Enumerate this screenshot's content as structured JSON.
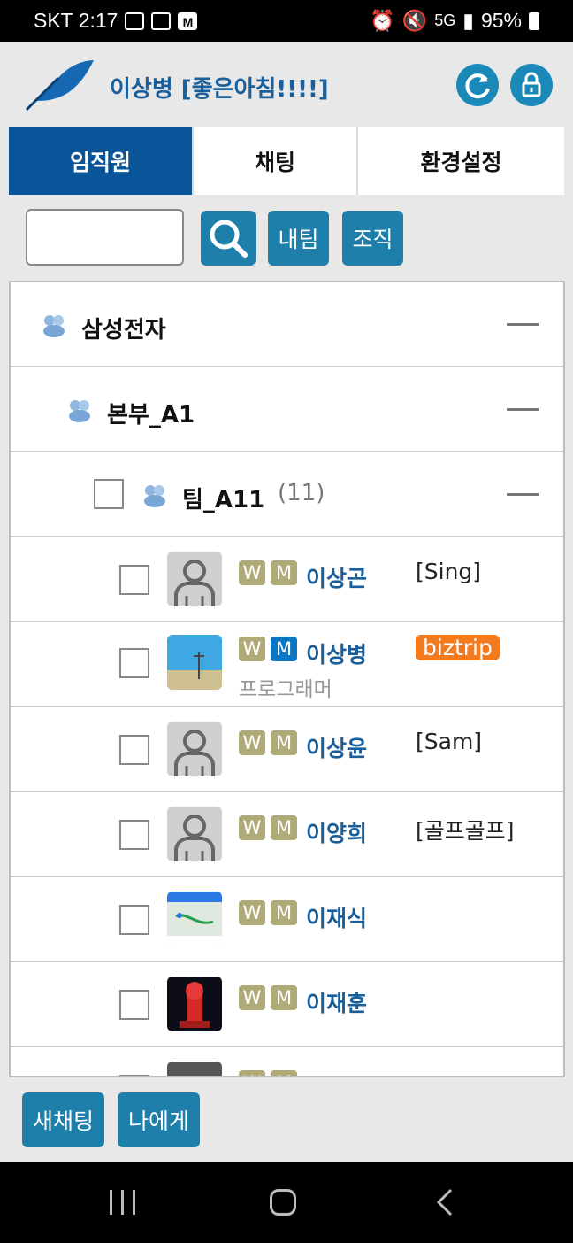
{
  "status_bar": {
    "carrier_time": "SKT 2:17",
    "battery": "95%",
    "icons": [
      "gallery-icon",
      "volte-icon",
      "stock-app-icon",
      "alarm-icon",
      "mute-icon",
      "5g-icon",
      "signal-icon",
      "battery-icon"
    ],
    "stock_icon_letter": "M",
    "network_label": "5G"
  },
  "header": {
    "title": "이상병 [좋은아침!!!!]",
    "logo_icon": "feather-logo-icon",
    "refresh_icon": "refresh-icon",
    "lock_icon": "lock-icon"
  },
  "tabs": [
    {
      "label": "임직원",
      "active": true
    },
    {
      "label": "채팅",
      "active": false
    },
    {
      "label": "환경설정",
      "active": false
    }
  ],
  "search": {
    "value": "",
    "search_icon": "search-icon",
    "my_team_label": "내팀",
    "org_label": "조직"
  },
  "tree": {
    "groups": [
      {
        "label": "삼성전자",
        "icon": "group-icon"
      },
      {
        "label": "본부_A1",
        "icon": "group-icon"
      },
      {
        "label": "팀_A11",
        "count": "(11)",
        "icon": "group-icon"
      }
    ],
    "members": [
      {
        "name": "이상곤",
        "tag": "[Sing]",
        "role": "",
        "w": "W",
        "m": "M",
        "m_online": false,
        "avatar": "default"
      },
      {
        "name": "이상병",
        "tag": "biztrip",
        "role": "프로그래머",
        "w": "W",
        "m": "M",
        "m_online": true,
        "avatar": "photo-sky"
      },
      {
        "name": "이상윤",
        "tag": "[Sam]",
        "role": "",
        "w": "W",
        "m": "M",
        "m_online": false,
        "avatar": "default"
      },
      {
        "name": "이양희",
        "tag": "[골프골프]",
        "role": "",
        "w": "W",
        "m": "M",
        "m_online": false,
        "avatar": "default"
      },
      {
        "name": "이재식",
        "tag": "",
        "role": "",
        "w": "W",
        "m": "M",
        "m_online": false,
        "avatar": "photo-map"
      },
      {
        "name": "이재훈",
        "tag": "",
        "role": "",
        "w": "W",
        "m": "M",
        "m_online": false,
        "avatar": "photo-tower"
      }
    ]
  },
  "bottom": {
    "new_chat_label": "새채팅",
    "to_me_label": "나에게"
  },
  "colors": {
    "primary": "#0a5599",
    "button": "#1f7fab",
    "name_text": "#1a5f9a",
    "badge_offline": "#b0aa78",
    "badge_online": "#0b76c2",
    "biztrip": "#f47a1e"
  }
}
